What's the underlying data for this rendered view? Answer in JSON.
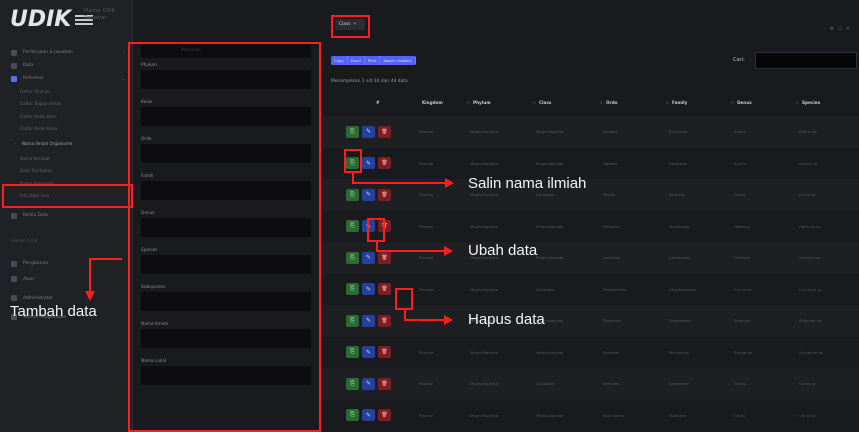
{
  "app": {
    "logo_text": "UDIK",
    "app_name": "Master UDIK",
    "user_name": "Registrar"
  },
  "sidebar": {
    "items": [
      {
        "label": "Pertanyaan & Jawaban"
      },
      {
        "label": "Data"
      },
      {
        "label": "Referensi"
      }
    ],
    "subitems": [
      {
        "label": "Daftar Phylum"
      },
      {
        "label": "Daftar Bagian Kelas"
      },
      {
        "label": "Daftar Kelas Kecil"
      },
      {
        "label": "Daftar Anak Kelas"
      }
    ],
    "active_item": "Nama Ilmiah Organisme",
    "subitems_after": [
      {
        "label": "Nama Kerabat"
      },
      {
        "label": "Data Tambahan"
      },
      {
        "label": "Nama Alternatif"
      },
      {
        "label": "Info Data Lain"
      }
    ],
    "section_title": "Kelola Data",
    "version_text": "Version 3.0.0",
    "items_bottom": [
      {
        "label": "Pengaturan"
      },
      {
        "label": "Akun"
      },
      {
        "label": "Administrator"
      },
      {
        "label": "Sistem Pengelolaan"
      }
    ]
  },
  "filter": {
    "search_placeholder": "Pencarian",
    "fields": [
      {
        "label": "Phylum"
      },
      {
        "label": "Kelas"
      },
      {
        "label": "Ordo"
      },
      {
        "label": "Famili"
      },
      {
        "label": "Genus"
      },
      {
        "label": "Spesies"
      },
      {
        "label": "Subspesies"
      },
      {
        "label": "Nama Ilmiah"
      },
      {
        "label": "Nama Lokal"
      }
    ]
  },
  "topbar": {
    "select_value": "Class",
    "window_controls": "– ⚙ ☐ ✕"
  },
  "toolbar": {
    "buttons": [
      {
        "label": "Copy"
      },
      {
        "label": "Excel"
      },
      {
        "label": "Print"
      },
      {
        "label": "Kolom visibility"
      }
    ],
    "search_label": "Cari:"
  },
  "table": {
    "showing_text": "Menampilkan 1 s/d 10 dari 44 data",
    "columns": [
      {
        "label": "#"
      },
      {
        "label": "Kingdom"
      },
      {
        "label": "Phylum"
      },
      {
        "label": "Class"
      },
      {
        "label": "Ordo"
      },
      {
        "label": "Family"
      },
      {
        "label": "Genus"
      },
      {
        "label": "Species"
      }
    ],
    "rows": [
      {
        "cells": [
          "Plantae",
          "Magnoliophyta",
          "Magnoliopsida",
          "Rosales",
          "Rosaceae",
          "Rubus",
          "Rubus sp."
        ]
      },
      {
        "cells": [
          "Plantae",
          "Magnoliophyta",
          "Magnoliopsida",
          "Fabales",
          "Fabaceae",
          "Acacia",
          "Acacia sp."
        ]
      },
      {
        "cells": [
          "Plantae",
          "Magnoliophyta",
          "Liliopsida",
          "Poales",
          "Poaceae",
          "Oryza",
          "Oryza sp."
        ]
      },
      {
        "cells": [
          "Plantae",
          "Magnoliophyta",
          "Magnoliopsida",
          "Malvales",
          "Malvaceae",
          "Hibiscus",
          "Hibiscus sp."
        ]
      },
      {
        "cells": [
          "Plantae",
          "Magnoliophyta",
          "Magnoliopsida",
          "Lamiales",
          "Lamiaceae",
          "Ocimum",
          "Ocimum sp."
        ]
      },
      {
        "cells": [
          "Plantae",
          "Magnoliophyta",
          "Liliopsida",
          "Zingiberales",
          "Zingiberaceae",
          "Curcuma",
          "Curcuma sp."
        ]
      },
      {
        "cells": [
          "Plantae",
          "Magnoliophyta",
          "Magnoliopsida",
          "Solanales",
          "Solanaceae",
          "Solanum",
          "Solanum sp."
        ]
      },
      {
        "cells": [
          "Plantae",
          "Magnoliophyta",
          "Magnoliopsida",
          "Myrtales",
          "Myrtaceae",
          "Syzygium",
          "Syzygium sp."
        ]
      },
      {
        "cells": [
          "Plantae",
          "Magnoliophyta",
          "Liliopsida",
          "Arecales",
          "Arecaceae",
          "Cocos",
          "Cocos sp."
        ]
      },
      {
        "cells": [
          "Plantae",
          "Magnoliophyta",
          "Magnoliopsida",
          "Sapindales",
          "Rutaceae",
          "Citrus",
          "Citrus sp."
        ]
      }
    ]
  },
  "annotations": {
    "copy": "Salin nama ilmiah",
    "edit": "Ubah data",
    "delete": "Hapus data",
    "add": "Tambah data"
  },
  "icons": {
    "copy": "copy-icon",
    "edit": "pencil-icon",
    "delete": "trash-icon"
  },
  "colors": {
    "highlight": "#ff1e1e",
    "accent": "#5263f5",
    "copy_button": "#2d6a33",
    "edit_button": "#23419d",
    "delete_button": "#7c1f24"
  }
}
